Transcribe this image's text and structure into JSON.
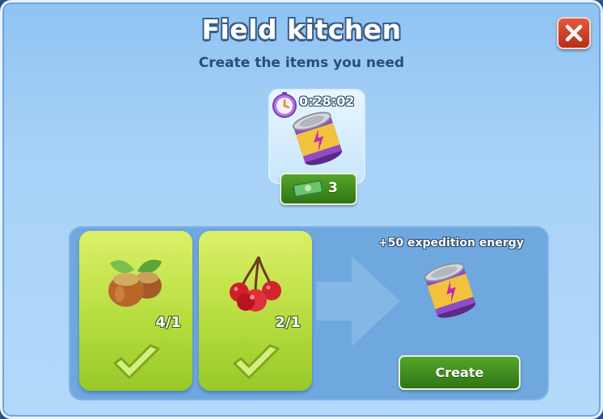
{
  "dialog": {
    "title": "Field kitchen",
    "subtitle": "Create the items you need"
  },
  "product": {
    "timer": "0:28:02",
    "icon": "energy-can-icon",
    "cost": "3",
    "cost_icon": "cash-bundle-icon"
  },
  "ingredients": [
    {
      "name_icon": "hazelnut-icon",
      "quantity": "4/1",
      "status_icon": "checkmark-icon"
    },
    {
      "name_icon": "cherry-icon",
      "quantity": "2/1",
      "status_icon": "checkmark-icon"
    }
  ],
  "reward": {
    "text": "+50 expedition energy",
    "icon": "energy-can-icon"
  },
  "actions": {
    "create_label": "Create",
    "close_icon": "close-icon"
  },
  "colors": {
    "panel_bg": "#a7d1f7",
    "card_green": "#b3db3c",
    "button_green": "#3f8c1e",
    "close_red": "#c9381e"
  }
}
